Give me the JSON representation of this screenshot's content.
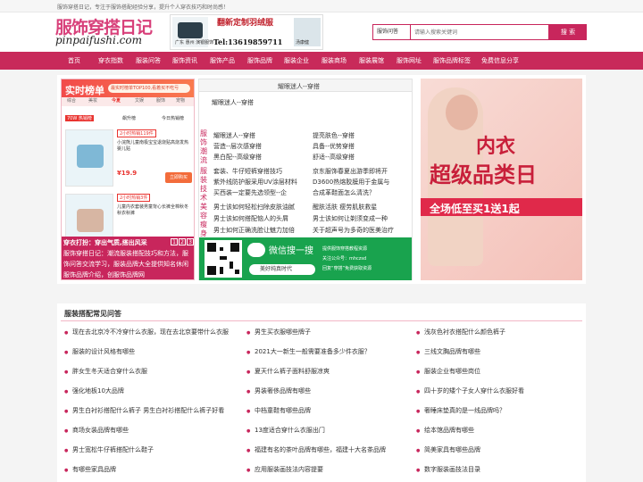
{
  "topbar": {
    "text": "服饰穿搭日记，专注于服饰搭配经验分享，提升个人穿衣技巧和时尚感！"
  },
  "header": {
    "logo_cn": "服饰穿搭日记",
    "logo_en": "pinpaifushi.com",
    "ad_title": "翻新定制羽绒服",
    "ad_left_label": "广东 惠州 演银服饰",
    "ad_tel": "Tel:13619859711",
    "ad_right_label": "汤康健"
  },
  "search": {
    "select_value": "服饰问答",
    "placeholder": "请输入搜索关键词",
    "button": "搜 索"
  },
  "nav": [
    "首页",
    "穿衣指数",
    "服装问答",
    "服饰资讯",
    "服饰产品",
    "服饰品牌",
    "服装企业",
    "服装商场",
    "服装展馆",
    "服饰网址",
    "服饰品牌标签",
    "免费信息分享"
  ],
  "ranking": {
    "title": "实时榜单",
    "subtitle": "最实时榜单TOP100,看着买不吃亏",
    "tabs": [
      "综合",
      "美妆",
      "今夏",
      "文娱",
      "服饰",
      "宠物"
    ],
    "tab_active": "今夏",
    "tag": "70W 热销榜",
    "sub_tabs": [
      "飙升榜",
      "今日热销榜"
    ],
    "products": [
      {
        "pill": "2小时热销119件",
        "label": "小浣熊儿童南极宝宝退烧贴高烧发热婴儿贴",
        "price": "¥19.9",
        "btn": "立即购买"
      },
      {
        "pill": "2小时热销3件",
        "label": "儿童内衣套装男童背心长裤全棉秋冬秋衣秋裤",
        "price": "",
        "btn": ""
      }
    ]
  },
  "ticker": {
    "label": "穿衣打扮：穿出气质,搭出风采",
    "pages": [
      "1",
      "2",
      "3"
    ],
    "text": "服饰穿搭日记：潮流服装搭配技巧和方法，服饰问答交流学习，服装品牌大全提供知名休闲服饰品牌介绍，创服饰品牌网"
  },
  "center": {
    "header": "耀眼迷人--穿搭",
    "sub": "耀眼迷人--穿搭",
    "labels": [
      "服饰潮流",
      "服装技术",
      "美容瘦身"
    ],
    "items_left": [
      "耀眼迷人--穿搭",
      "营造--层次感穿搭",
      "黑白配--高级穿搭",
      "套装、牛仔短裤穿搭技巧",
      "紫外线防护服采用UV涂层材料",
      "买西装一定要先选领型--企",
      "男士该如何轻松扫除皮肤油腻",
      "男士该如何搭配恼人的头屑",
      "男士如何正确洗脸让魅力加倍"
    ],
    "items_right": [
      "提亮肤色--穿搭",
      "具备--优势穿搭",
      "舒适--高级穿搭",
      "京东服饰春夏出游季即将开",
      "D3600热熔胶膜用于金属与",
      "合成革鞋面怎么清洗？",
      "醒肤活肤 瘦劳肌肤救星",
      "男士该如何让剃须变成一种",
      "关于超声号为多奇的医美治疗"
    ],
    "wechat_title": "微信搜一搜",
    "search_label": "美好纯真时代",
    "right_lines": [
      "提供服饰穿搭教程资源",
      "关注公众号：mhczsd",
      "回复“穿搭”免费获取资源"
    ]
  },
  "banner": {
    "line1": "内衣",
    "line2": "超级品类日",
    "band": "全场低至买1送1起"
  },
  "faq": {
    "title": "服装搭配常见问答",
    "items": [
      "现在去北京冷不冷穿什么衣服，现在去北京要带什么衣服",
      "男生买衣服哪些牌子",
      "浅灰色衬衣搭配什么颜色裤子",
      "服装的设计风格有哪些",
      "2021大一新生一般需要准备多少件衣服？",
      "三线文胸品牌有哪些",
      "胖女生冬天适合穿什么衣服",
      "夏天什么裤子面料舒服凉爽",
      "服装企业有哪些岗位",
      "强化地板10大品牌",
      "男装奢侈品牌有哪些",
      "四十岁的矮个子女人穿什么衣服好看",
      "男生白衬衫搭配什么裤子 男生白衬衫搭配什么裤子好看",
      "中档童鞋有哪些品牌",
      "奢睡床垫真的是一线品牌吗？",
      "商场女装品牌有哪些",
      "13度适合穿什么衣服出门",
      "绘本馆品牌有哪些",
      "男士宽松牛仔裤搭配什么鞋子",
      "福建有名的茶叶品牌有哪些，福建十大名茶品牌",
      "简美家具有哪些品牌",
      "有哪些家具品牌",
      "应用服装画技法内容提要",
      "数字服装画技法目录"
    ]
  }
}
